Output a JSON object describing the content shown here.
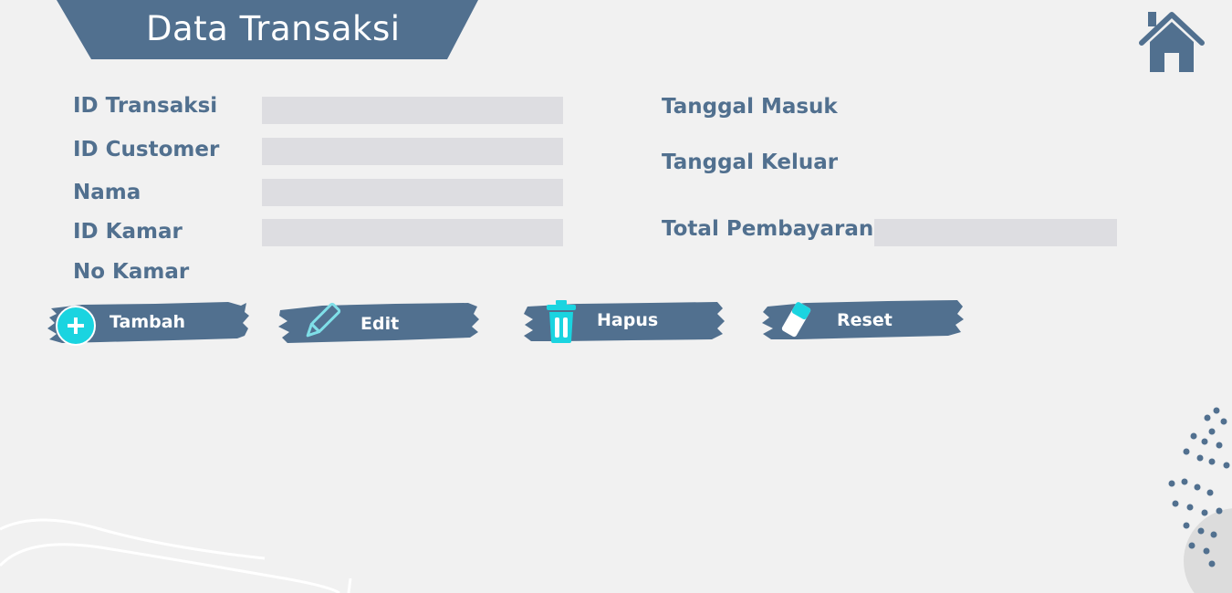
{
  "header": {
    "title": "Data Transaksi"
  },
  "nav": {
    "home_icon": "home-icon"
  },
  "form": {
    "id_transaksi": {
      "label": "ID Transaksi",
      "value": ""
    },
    "id_customer": {
      "label": "ID Customer",
      "value": ""
    },
    "nama": {
      "label": "Nama",
      "value": ""
    },
    "id_kamar": {
      "label": "ID Kamar",
      "value": ""
    },
    "no_kamar": {
      "label": "No Kamar"
    },
    "tanggal_masuk": {
      "label": "Tanggal Masuk"
    },
    "tanggal_keluar": {
      "label": "Tanggal Keluar"
    },
    "total_pembayaran": {
      "label": "Total Pembayaran",
      "value": ""
    }
  },
  "actions": {
    "tambah": {
      "label": "Tambah",
      "icon": "plus-circle-icon"
    },
    "edit": {
      "label": "Edit",
      "icon": "pencil-icon"
    },
    "hapus": {
      "label": "Hapus",
      "icon": "trash-icon"
    },
    "reset": {
      "label": "Reset",
      "icon": "eraser-icon"
    }
  },
  "colors": {
    "primary": "#51708f",
    "accent": "#1ad4e0",
    "field_bg": "#dddde1",
    "background": "#f1f1f1"
  }
}
